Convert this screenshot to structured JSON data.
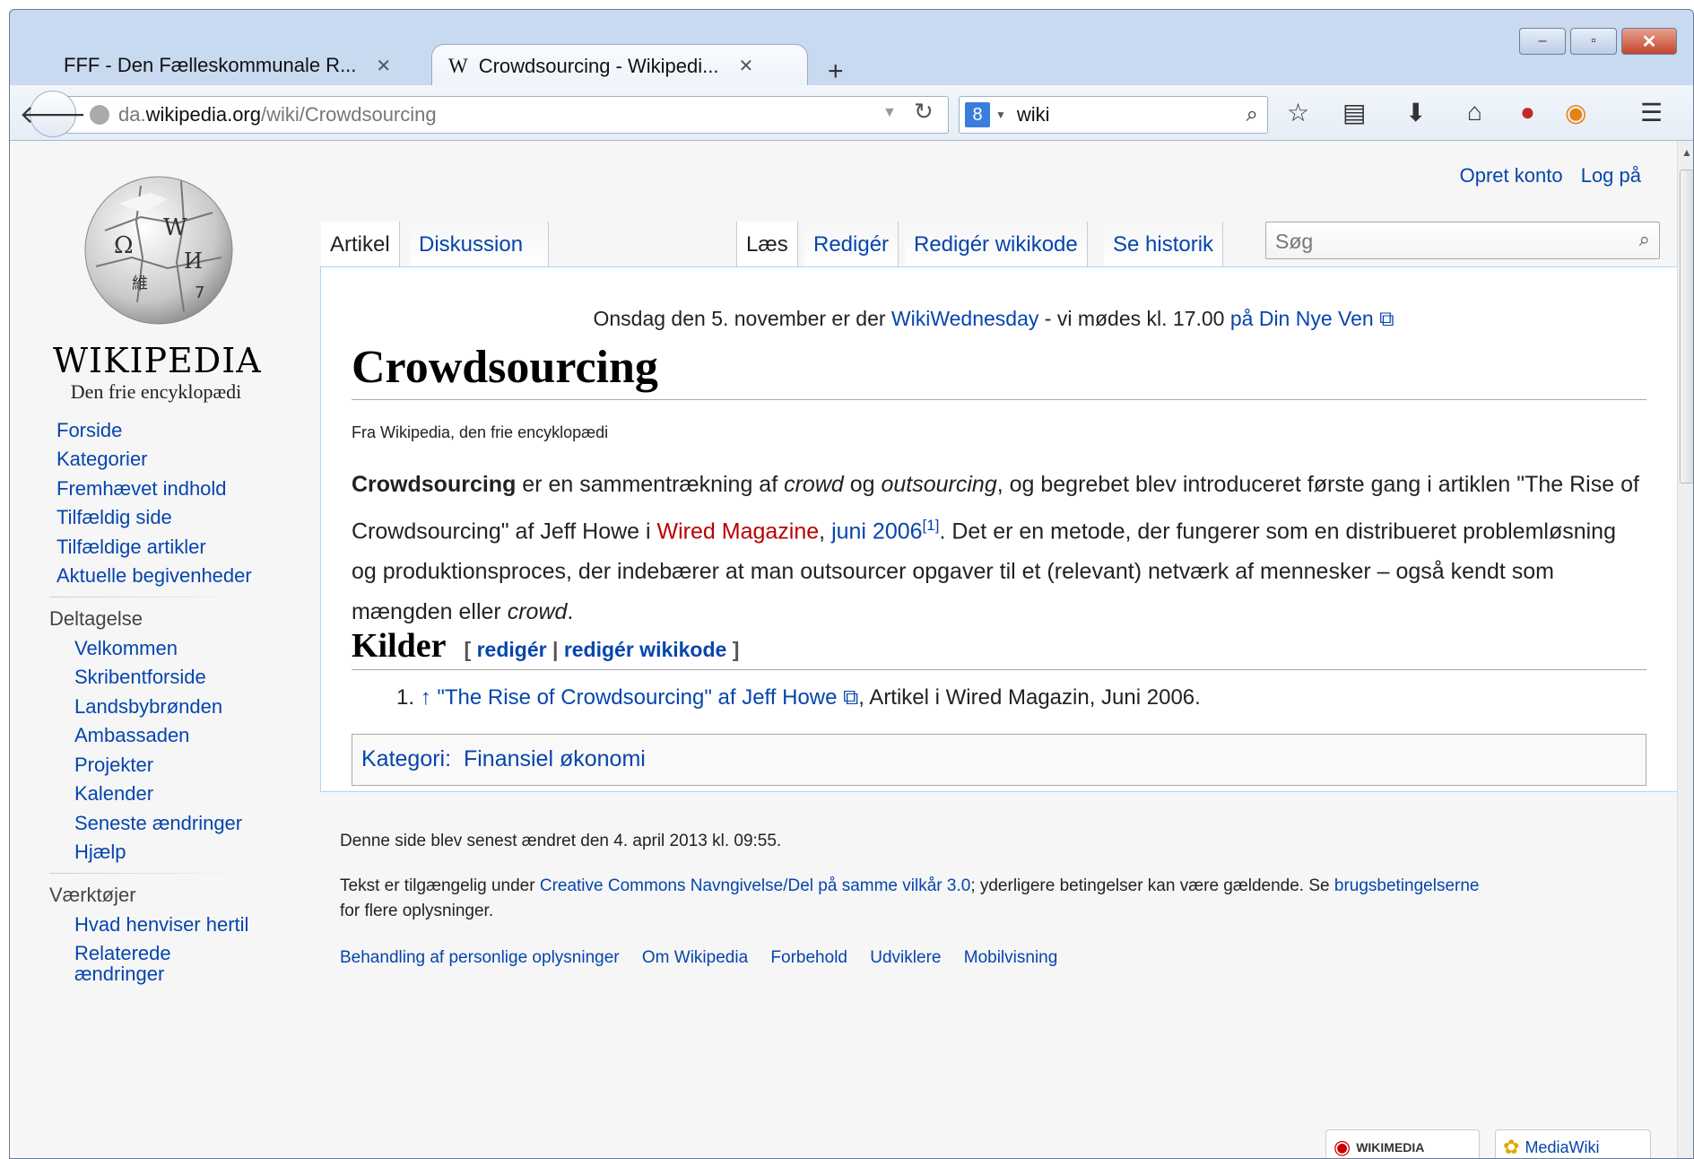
{
  "browser": {
    "tabs": [
      {
        "title": "FFF - Den Fælleskommunale R...",
        "close": "✕"
      },
      {
        "favicon": "W",
        "title": "Crowdsourcing - Wikipedi...",
        "close": "✕"
      }
    ],
    "new_tab": "+",
    "window_controls": {
      "minimize": "–",
      "maximize": "▫",
      "close": "✕"
    },
    "url": {
      "prefix": "da.",
      "host": "wikipedia.org",
      "path": "/wiki/Crowdsourcing"
    },
    "search": {
      "engine": "8",
      "query": "wiki"
    },
    "icons": [
      "star-icon",
      "reading-list-icon",
      "download-icon",
      "home-icon",
      "addon-red-icon",
      "addon-orange-icon",
      "menu-icon"
    ]
  },
  "wiki": {
    "logo": {
      "wordmark": "WIKIPEDIA",
      "tagline": "Den frie encyklopædi"
    },
    "personal": {
      "create_account": "Opret konto",
      "login": "Log på"
    },
    "tabs_left": [
      "Artikel",
      "Diskussion"
    ],
    "tabs_right": [
      "Læs",
      "Redigér",
      "Redigér wikikode",
      "Se historik"
    ],
    "search_placeholder": "Søg",
    "sidebar": {
      "nav": [
        "Forside",
        "Kategorier",
        "Fremhævet indhold",
        "Tilfældig side",
        "Tilfældige artikler",
        "Aktuelle begivenheder"
      ],
      "participation_title": "Deltagelse",
      "participation": [
        "Velkommen",
        "Skribentforside",
        "Landsbybrønden",
        "Ambassaden",
        "Projekter",
        "Kalender",
        "Seneste ændringer",
        "Hjælp"
      ],
      "tools_title": "Værktøjer",
      "tools": [
        "Hvad henviser hertil",
        "Relaterede",
        "ændringer"
      ]
    },
    "sitenotice": {
      "pre": "Onsdag den 5. november er der ",
      "link1": "WikiWednesday",
      "mid": " - vi mødes kl. 17.00 ",
      "link2": "på Din Nye Ven"
    },
    "title": "Crowdsourcing",
    "site_sub": "Fra Wikipedia, den frie encyklopædi",
    "body": {
      "bold": "Crowdsourcing",
      "t1": " er en sammentrækning af ",
      "i1": "crowd",
      "t2": " og ",
      "i2": "outsourcing",
      "t3": ", og begrebet blev introduceret første gang i artiklen \"The Rise of Crowdsourcing\" af Jeff Howe i ",
      "redlink": "Wired Magazine",
      "t4": ", ",
      "link_date": "juni 2006",
      "sup": "[1]",
      "t5": ". Det er en metode, der fungerer som en distribueret problemløsning og produktionsproces, der indebærer at man outsourcer opgaver til et (relevant) netværk af mennesker – også kendt som mængden eller ",
      "i3": "crowd",
      "t6": "."
    },
    "section": {
      "title": "Kilder",
      "edit_open": "[ ",
      "edit": "redigér",
      "sep": " | ",
      "edit_source": "redigér wikikode",
      "edit_close": " ]"
    },
    "reference": {
      "num": "1.",
      "arrow": "↑",
      "link": "\"The Rise of Crowdsourcing\" af Jeff Howe",
      "rest": ", Artikel i Wired Magazin, Juni 2006."
    },
    "category": {
      "label": "Kategori:",
      "value": "Finansiel økonomi"
    },
    "footer": {
      "modified": "Denne side blev senest ændret den 4. april 2013 kl. 09:55.",
      "license_pre": "Tekst er tilgængelig under ",
      "license_link": "Creative Commons Navngivelse/Del på samme vilkår 3.0",
      "license_mid": "; yderligere betingelser kan være gældende. Se ",
      "terms_link": "brugsbetingelserne",
      "license_post": "for flere oplysninger.",
      "links": [
        "Behandling af personlige oplysninger",
        "Om Wikipedia",
        "Forbehold",
        "Udviklere",
        "Mobilvisning"
      ],
      "badge1": "WIKIMEDIA",
      "badge2": "MediaWiki"
    }
  }
}
